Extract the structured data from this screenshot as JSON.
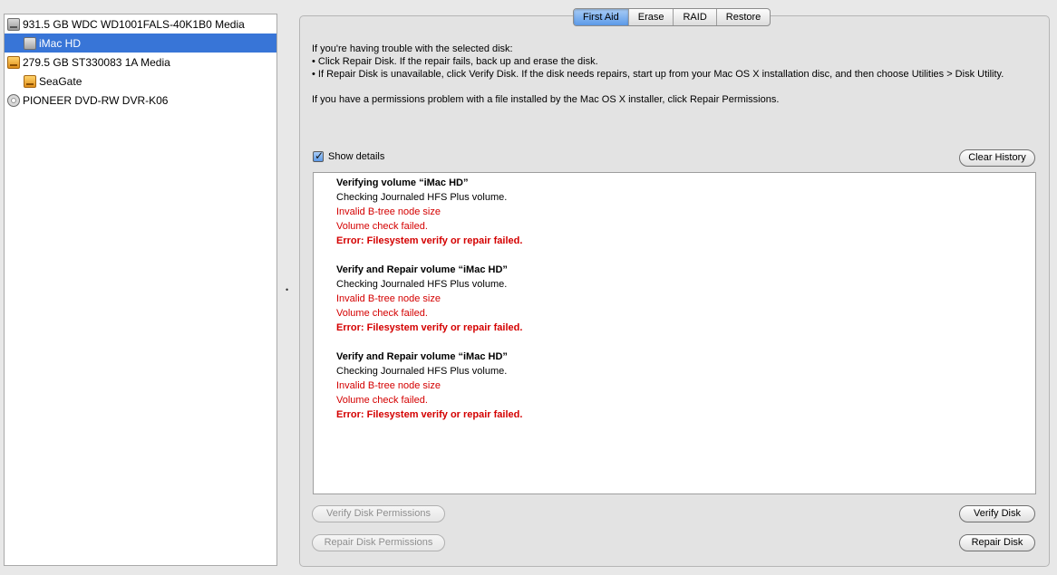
{
  "sidebar": {
    "items": [
      {
        "label": "931.5 GB WDC WD1001FALS-40K1B0 Media",
        "icon": "hard-drive-icon",
        "level": 0,
        "selected": false
      },
      {
        "label": "iMac HD",
        "icon": "volume-icon",
        "level": 1,
        "selected": true
      },
      {
        "label": "279.5 GB ST330083 1A Media",
        "icon": "external-drive-icon",
        "level": 0,
        "selected": false
      },
      {
        "label": "SeaGate",
        "icon": "external-volume-icon",
        "level": 1,
        "selected": false
      },
      {
        "label": "PIONEER DVD-RW DVR-K06",
        "icon": "optical-drive-icon",
        "level": 0,
        "selected": false
      }
    ]
  },
  "tabs": [
    {
      "label": "First Aid",
      "active": true
    },
    {
      "label": "Erase",
      "active": false
    },
    {
      "label": "RAID",
      "active": false
    },
    {
      "label": "Restore",
      "active": false
    }
  ],
  "intro": {
    "line1": "If you're having trouble with the selected disk:",
    "bullet1": "• Click Repair Disk. If the repair fails, back up and erase the disk.",
    "bullet2": "• If Repair Disk is unavailable, click Verify Disk. If the disk needs repairs, start up from your Mac OS X installation disc, and then choose Utilities > Disk Utility.",
    "line2": "If you have a permissions problem with a file installed by the Mac OS X installer, click Repair Permissions."
  },
  "show_details": {
    "label": "Show details",
    "checked": true
  },
  "buttons": {
    "clear_history": "Clear History",
    "verify_permissions": "Verify Disk Permissions",
    "repair_permissions": "Repair Disk Permissions",
    "verify_disk": "Verify Disk",
    "repair_disk": "Repair Disk"
  },
  "log": {
    "entries": [
      {
        "heading": "Verifying volume “iMac HD”",
        "lines": [
          {
            "text": "Checking Journaled HFS Plus volume.",
            "style": "normal"
          },
          {
            "text": "Invalid B-tree node size",
            "style": "error"
          },
          {
            "text": "Volume check failed.",
            "style": "error"
          },
          {
            "text": "Error: Filesystem verify or repair failed.",
            "style": "error-bold"
          }
        ]
      },
      {
        "heading": "Verify and Repair volume “iMac HD”",
        "lines": [
          {
            "text": "Checking Journaled HFS Plus volume.",
            "style": "normal"
          },
          {
            "text": "Invalid B-tree node size",
            "style": "error"
          },
          {
            "text": "Volume check failed.",
            "style": "error"
          },
          {
            "text": "Error: Filesystem verify or repair failed.",
            "style": "error-bold"
          }
        ]
      },
      {
        "heading": "Verify and Repair volume “iMac HD”",
        "lines": [
          {
            "text": "Checking Journaled HFS Plus volume.",
            "style": "normal"
          },
          {
            "text": "Invalid B-tree node size",
            "style": "error"
          },
          {
            "text": "Volume check failed.",
            "style": "error"
          },
          {
            "text": "Error: Filesystem verify or repair failed.",
            "style": "error-bold"
          }
        ]
      }
    ]
  },
  "colors": {
    "selection": "#3875d7",
    "error": "#d40000",
    "tab_active": "#5c9ae8"
  }
}
